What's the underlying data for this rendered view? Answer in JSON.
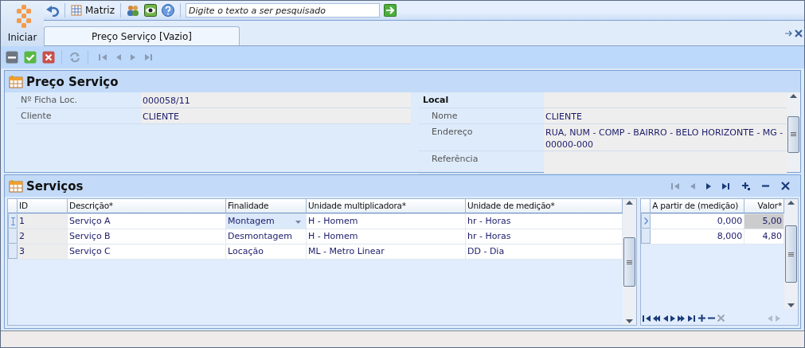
{
  "toolbar": {
    "start_label": "Iniciar",
    "matrix_button": "Matriz",
    "search": {
      "placeholder": "Digite o texto a ser pesquisado"
    }
  },
  "tabs": [
    {
      "label": "Preço Serviço [Vazio]",
      "selected": true
    }
  ],
  "header_panel": {
    "title": "Preço Serviço",
    "fields": [
      {
        "label": "Nº Ficha Loc.",
        "value": "000058/11"
      },
      {
        "label": "Cliente",
        "value": "CLIENTE"
      }
    ],
    "local": {
      "title": "Local",
      "fields": [
        {
          "label": "Nome",
          "value": "CLIENTE"
        },
        {
          "label": "Endereço",
          "value": "RUA, NUM - COMP - BAIRRO - BELO HORIZONTE - MG - 00000-000"
        },
        {
          "label": "Referência"
        }
      ]
    }
  },
  "services": {
    "title": "Serviços",
    "columns": [
      "ID",
      "Descrição*",
      "Finalidade",
      "Unidade multiplicadora*",
      "Unidade de medição*"
    ],
    "rows": [
      {
        "cells": [
          "1",
          "Serviço A",
          "Montagem",
          "H - Homem",
          "hr - Horas"
        ],
        "selected": true
      },
      {
        "cells": [
          "2",
          "Serviço B",
          "Desmontagem",
          "H - Homem",
          "hr - Horas"
        ],
        "selected": false
      },
      {
        "cells": [
          "3",
          "Serviço C",
          "Locação",
          "ML - Metro Linear",
          "DD - Dia"
        ],
        "selected": false
      }
    ]
  },
  "prices": {
    "columns": [
      "A partir de (medição)",
      "Valor*"
    ],
    "rows": [
      {
        "cells": [
          "0,000",
          "5,00"
        ],
        "selected": true
      },
      {
        "cells": [
          "8,000",
          "4,80"
        ],
        "selected": false
      }
    ]
  }
}
